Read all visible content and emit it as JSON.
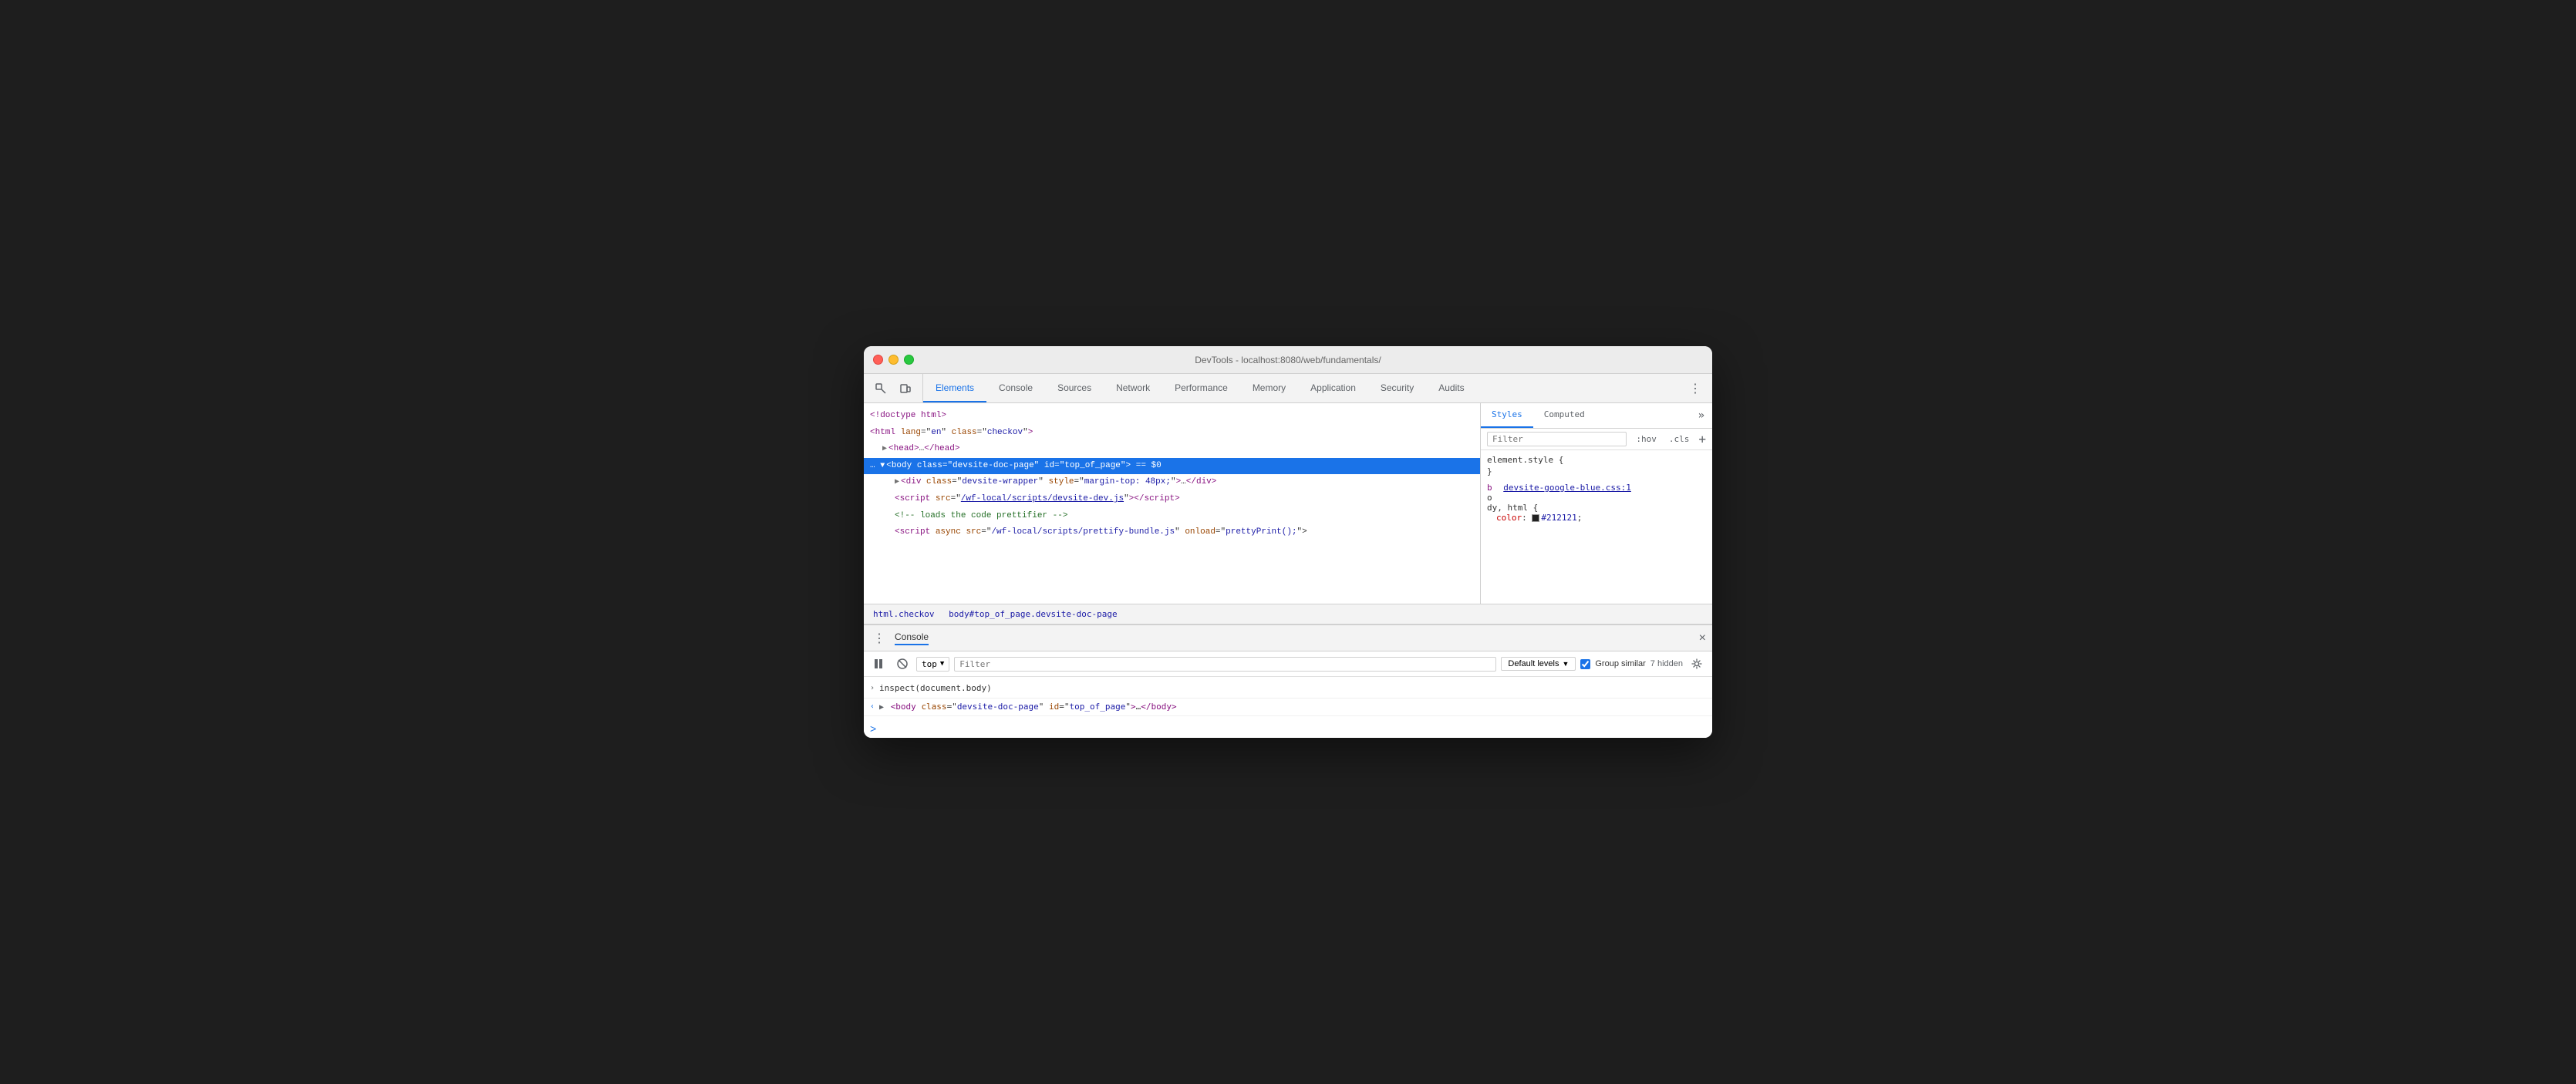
{
  "window": {
    "title": "DevTools - localhost:8080/web/fundamentals/"
  },
  "tabs": {
    "items": [
      {
        "id": "elements",
        "label": "Elements",
        "active": true
      },
      {
        "id": "console",
        "label": "Console",
        "active": false
      },
      {
        "id": "sources",
        "label": "Sources",
        "active": false
      },
      {
        "id": "network",
        "label": "Network",
        "active": false
      },
      {
        "id": "performance",
        "label": "Performance",
        "active": false
      },
      {
        "id": "memory",
        "label": "Memory",
        "active": false
      },
      {
        "id": "application",
        "label": "Application",
        "active": false
      },
      {
        "id": "security",
        "label": "Security",
        "active": false
      },
      {
        "id": "audits",
        "label": "Audits",
        "active": false
      }
    ]
  },
  "elements_panel": {
    "lines": [
      {
        "indent": 0,
        "content": "<!doctype html>"
      },
      {
        "indent": 0,
        "content": "<html lang=\"en\" class=\"checkov\">"
      },
      {
        "indent": 1,
        "content": "▶ <head>…</head>"
      },
      {
        "indent": 0,
        "content": "… ▼ <body class=\"devsite-doc-page\" id=\"top_of_page\"> == $0",
        "selected": true
      },
      {
        "indent": 2,
        "content": "▶ <div class=\"devsite-wrapper\" style=\"margin-top: 48px;\">…</div>"
      },
      {
        "indent": 2,
        "content": "<script src=\"/wf-local/scripts/devsite-dev.js\"></script>"
      },
      {
        "indent": 2,
        "content": "<!-- loads the code prettifier -->"
      },
      {
        "indent": 2,
        "content": "<script async src=\"/wf-local/scripts/prettify-bundle.js\" onload=\"prettyPrint();\">"
      }
    ]
  },
  "breadcrumb": {
    "items": [
      {
        "label": "html.checkov"
      },
      {
        "label": "body#top_of_page.devsite-doc-page"
      }
    ]
  },
  "styles_panel": {
    "tabs": [
      {
        "label": "Styles",
        "active": true
      },
      {
        "label": "Computed",
        "active": false
      }
    ],
    "filter_placeholder": "Filter",
    "hov_label": ":hov",
    "cls_label": ".cls",
    "plus_label": "+",
    "rules": [
      {
        "selector": "element.style {",
        "closing": "}",
        "props": []
      },
      {
        "selector_prefix": "b",
        "source_link": "devsite-google-blue.css:1",
        "selector_suffix": "o",
        "selector_line2": "dy, html {",
        "closing": "",
        "props": [
          {
            "name": "color",
            "value": "#212121",
            "has_swatch": true
          }
        ]
      }
    ]
  },
  "console_drawer": {
    "title": "Console",
    "close_label": "×",
    "toolbar": {
      "execute_label": "▶",
      "block_label": "⊘",
      "context_label": "top",
      "context_arrow": "▼",
      "filter_placeholder": "Filter",
      "levels_label": "Default levels",
      "levels_arrow": "▼",
      "group_similar_checked": true,
      "group_similar_label": "Group similar",
      "hidden_count": "7 hidden",
      "settings_label": "⚙"
    },
    "lines": [
      {
        "arrow": "›",
        "arrow_color": "gray",
        "content": "inspect(document.body)"
      },
      {
        "arrow": "‹",
        "arrow_color": "blue",
        "content": "<body class=\"devsite-doc-page\" id=\"top_of_page\">…</body>"
      }
    ],
    "prompt_caret": ">"
  }
}
